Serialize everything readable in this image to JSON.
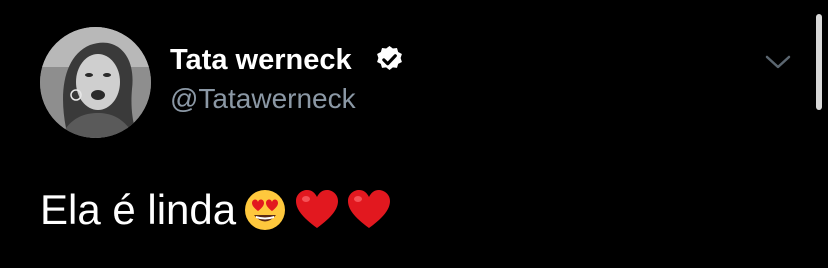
{
  "tweet": {
    "author": {
      "display_name": "Tata werneck",
      "handle": "@Tatawerneck",
      "verified": true,
      "avatar_icon": "profile-photo"
    },
    "text": "Ela é linda",
    "emojis": [
      "smiling-face-with-heart-eyes",
      "red-heart",
      "red-heart"
    ],
    "menu_icon": "chevron-down-icon"
  },
  "colors": {
    "background": "#000000",
    "text": "#ffffff",
    "secondary_text": "#8b98a5",
    "heart": "#e2181f",
    "emoji_face": "#ffc83d"
  }
}
